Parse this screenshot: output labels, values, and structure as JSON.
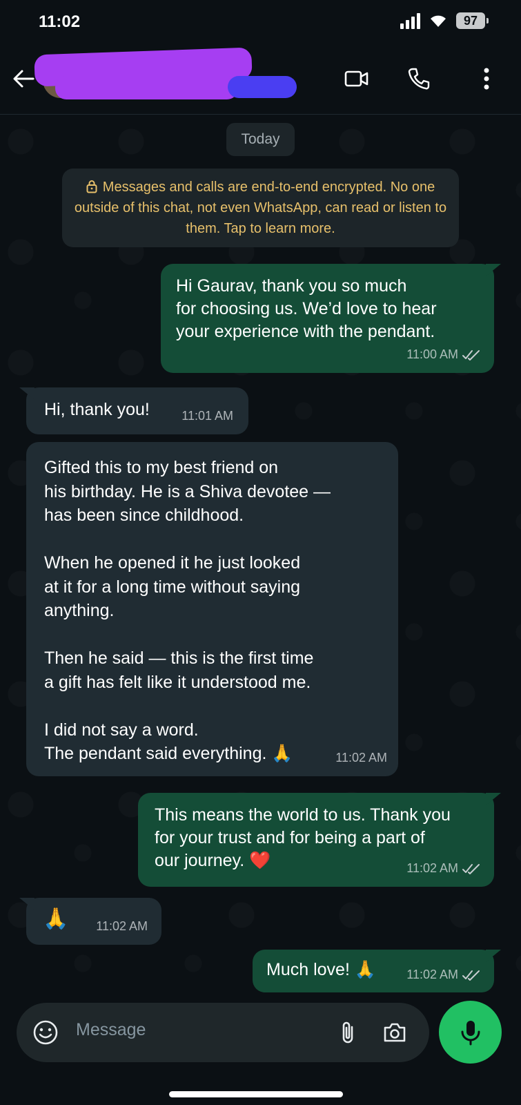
{
  "status_bar": {
    "time": "11:02",
    "battery": "97"
  },
  "header": {
    "contact_name": "",
    "icons": [
      "back-arrow-icon",
      "video-call-icon",
      "voice-call-icon",
      "more-options-icon"
    ]
  },
  "chat": {
    "date_chip": "Today",
    "encryption_notice": "Messages and calls are end-to-end encrypted. No one outside of this chat, not even WhatsApp, can read or listen to them. Tap to learn more.",
    "messages": [
      {
        "direction": "outgoing",
        "text": "Hi Gaurav, thank you so much\nfor choosing us. We’d love to hear\nyour experience with the pendant.",
        "time": "11:00 AM",
        "status": "read"
      },
      {
        "direction": "incoming",
        "text": "Hi, thank you!",
        "time": "11:01 AM"
      },
      {
        "direction": "incoming",
        "text": "Gifted this to my best friend on\nhis birthday. He is a Shiva devotee —\nhas been since childhood.\n\nWhen he opened it he just looked\nat it for a long time without saying\nanything.\n\nThen he said — this is the first time\na gift has felt like it understood me.\n\nI did not say a word.\nThe pendant said everything. 🙏",
        "time": "11:02 AM"
      },
      {
        "direction": "outgoing",
        "text": "This means the world to us. Thank you\nfor your trust and for being a part of\nour journey.  ❤️",
        "time": "11:02 AM",
        "status": "read"
      },
      {
        "direction": "incoming",
        "text": "🙏",
        "time": "11:02 AM"
      },
      {
        "direction": "outgoing",
        "text": "Much love! 🙏",
        "time": "11:02 AM",
        "status": "read"
      }
    ]
  },
  "composer": {
    "placeholder": "Message"
  },
  "colors": {
    "background": "#0b1014",
    "outgoing_bubble": "#144d37",
    "incoming_bubble": "#202c33",
    "accent": "#21c063",
    "encryption_text": "#e7c06b"
  }
}
